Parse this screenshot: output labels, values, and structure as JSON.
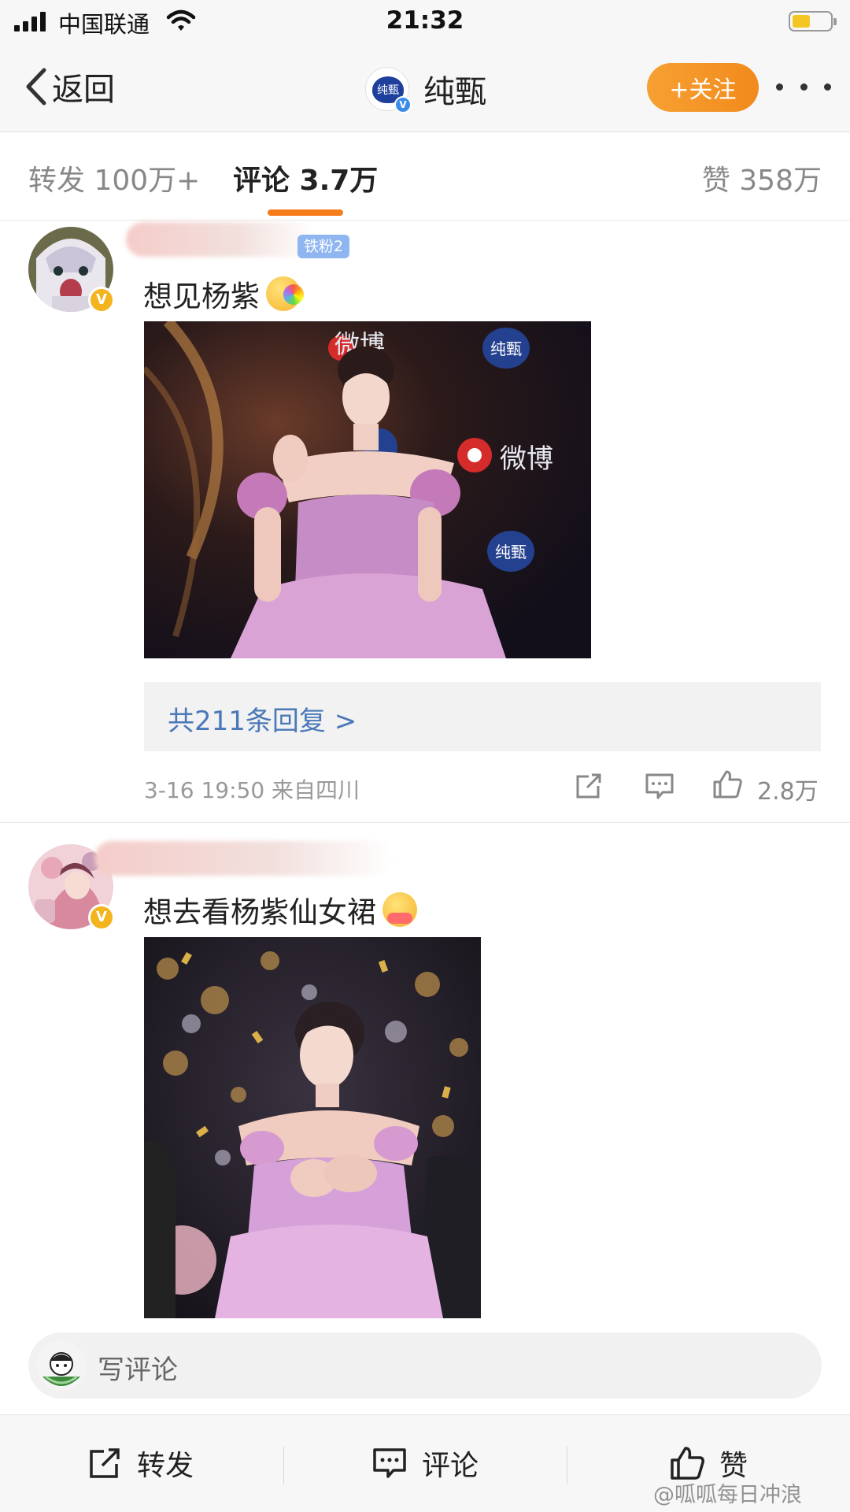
{
  "status_bar": {
    "carrier": "中国联通",
    "time": "21:32"
  },
  "nav": {
    "back_label": "返回",
    "account_name": "纯甄",
    "account_logo_text": "纯甄",
    "follow_label": "+关注"
  },
  "tabs": [
    {
      "label": "转发 100万+"
    },
    {
      "label": "评论 3.7万"
    },
    {
      "label": "赞 358万"
    }
  ],
  "comments": [
    {
      "fan_badge": "铁粉2",
      "text": "想见杨紫",
      "emoji": "rainbow-kiss-emoji",
      "replies_label": "共211条回复 >",
      "meta": "3-16 19:50  来自四川",
      "like_count": "2.8万"
    },
    {
      "text": "想去看杨紫仙女裙",
      "emoji": "hug-emoji"
    }
  ],
  "photo_watermarks": {
    "weibo": "微博",
    "brand": "纯甄"
  },
  "write_comment_placeholder": "写评论",
  "bottom_bar": {
    "repost_label": "转发",
    "comment_label": "评论",
    "like_label": "赞"
  },
  "watermark": "@呱呱每日冲浪",
  "colors": {
    "accent_orange": "#f57c1a",
    "follow_gradient": "#f7a033",
    "link_blue": "#4a78b8",
    "verified_gold": "#f3b41d"
  }
}
